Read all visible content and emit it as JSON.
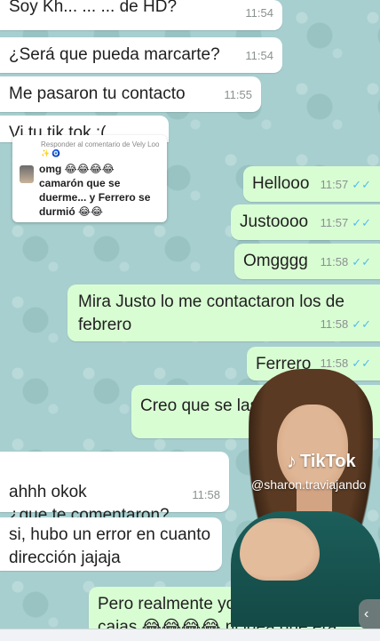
{
  "incoming": [
    {
      "text": "Soy Kh... ... ... de HD?",
      "time": "11:54"
    },
    {
      "text": "¿Será que pueda marcarte?",
      "time": "11:54"
    },
    {
      "text": "Me pasaron tu contacto",
      "time": "11:55"
    },
    {
      "text": "Vi tu tik tok :(",
      "time": ""
    }
  ],
  "reply_card": {
    "header": "Responder al comentario de Vely Loo ✨ 🧿",
    "body": "omg 😂😂😂😂 camarón que se duerme... y Ferrero se durmió 😂😂"
  },
  "outgoing": [
    {
      "text": "Hellooo",
      "time": "11:57"
    },
    {
      "text": "Justoooo",
      "time": "11:57"
    },
    {
      "text": "Omgggg",
      "time": "11:58"
    },
    {
      "text": "Mira Justo lo me contactaron los de febrero",
      "time": "11:58"
    },
    {
      "text": "Ferrero",
      "time": "11:58"
    },
    {
      "text": "Creo que se las va...sar",
      "time": ""
    }
  ],
  "incoming_late": [
    {
      "text": "ahhh okok\n¿que te comentaron?",
      "time": "11:58"
    },
    {
      "text": "si, hubo un error en cuanto dirección jajaja",
      "time": ""
    }
  ],
  "outgoing_last": {
    "text": "Pero realmente yo ayer repartí las cajas 😂😂😂😂 ni idea que era"
  },
  "ticks": "✓✓",
  "tiktok": {
    "logo": "TikTok",
    "handle": "@sharon.traviajando"
  },
  "colors": {
    "incoming": "#ffffff",
    "outgoing": "#d9fdd3",
    "ticks": "#53bdeb",
    "wallpaper": "#a7cfcf"
  }
}
